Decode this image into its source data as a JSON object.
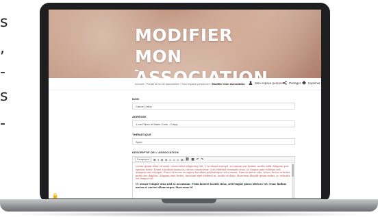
{
  "left_fragments": [
    "s",
    ",",
    "-",
    "s",
    "-"
  ],
  "hero": {
    "title_line1": "MODIFIER MON",
    "title_line2": "ASSOCIATION"
  },
  "breadcrumb": {
    "items": [
      "Accueil",
      "Portail de la vie associative",
      "Mon espace personnel"
    ],
    "separator": "›",
    "current": "Modifier mon association"
  },
  "top_actions": {
    "personal_space": "Mon espace personnel",
    "share": "Partager",
    "print": "Imprimer"
  },
  "form": {
    "name_label": "NOM",
    "name_value": "Canoe Crépy",
    "address_label": "ADRESSE",
    "address_value": "1 rue Pierre et Marie Curie - Crépy",
    "theme_label": "THÉMATIQUE",
    "theme_value": "Sport",
    "description_label": "DESCRIPTIF DE L'ASSOCIATION"
  },
  "editor": {
    "paragraph_format": "Paragraphe",
    "toolbar_buttons": [
      "B",
      "I",
      "U",
      "S",
      "≡",
      "≡",
      "≡",
      "Ω",
      "⛓",
      "▦",
      "↶",
      "↷"
    ],
    "paragraph1": "Lorem ipsum dolor sit amet, consectetur adipiscing elit. Ut a massa suscipit, accumsan nisi lacinia, iaculis nibh. Aliquam quis egestas tortor. Donec tincidunt massa in cursus consectetur. Cras eleifend venenatis risus, id congue ante volutpat sed. Aliquam erat volutpat. Fusce et luctus ex sapien tincidunt pellentesque vel a massa. Nam id metus odio. Donec luctus vehicula purus nec dapibus. Aliquam ante lectus, tincidunt eget eleifend ut, iaculis et diam. Maecenas blandit ipsum metus, ac vehicula est tempor vel.",
    "paragraph2": "Ut ornare tempor urna nisl ac accumsan. Proin laoreet iaculis risus, sed feugiat purus ultrices vel. Nunc finibus metus et auctor ullamcorper. Maecenas id"
  },
  "colors": {
    "laptop_bezel": "#1e1e20",
    "hero_accent": "#c99a86",
    "link_red": "#b44444",
    "lock_icon": "#f2b705"
  }
}
